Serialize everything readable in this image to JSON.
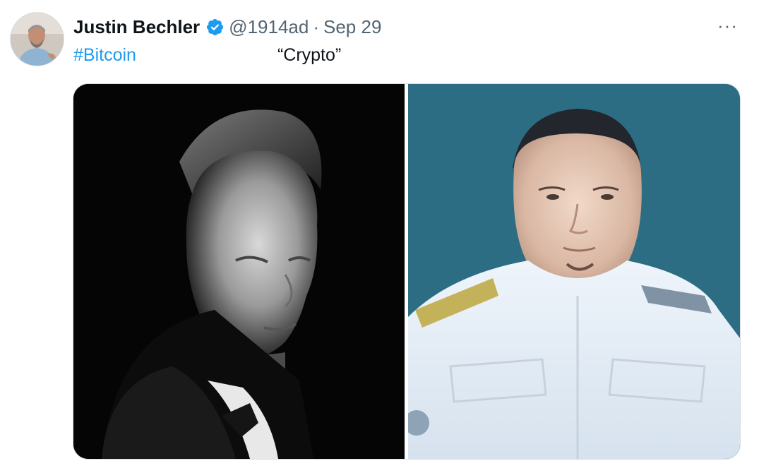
{
  "author": {
    "name": "Justin Bechler",
    "handle": "@1914ad",
    "separator": "·",
    "date": "Sep 29",
    "verified_color": "#1d9bf0"
  },
  "tweet": {
    "hashtag": "#Bitcoin",
    "text": "“Crypto”"
  },
  "more_menu": {
    "label": "···"
  },
  "media": {
    "count": 2,
    "photos": [
      "photo-left",
      "photo-right"
    ]
  },
  "colors": {
    "link": "#1d9bf0",
    "secondary": "#536471",
    "primary_text": "#0f1419"
  }
}
